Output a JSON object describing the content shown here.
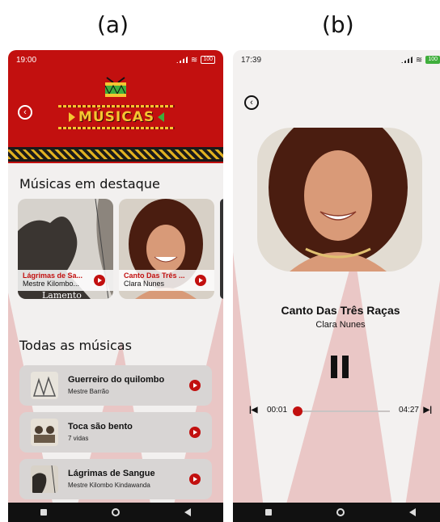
{
  "labels": {
    "a": "(a)",
    "b": "(b)"
  },
  "colors": {
    "accent": "#c2100f",
    "gold": "#f4c531",
    "green": "#3fae3c"
  },
  "screenA": {
    "status": {
      "time": "19:00",
      "battery": "100"
    },
    "header_title": "MÚSICAS",
    "featured_title": "Músicas em destaque",
    "featured": [
      {
        "title": "Lágrimas de Sa...",
        "artist": "Mestre Kilombo...",
        "caption": "Lamento"
      },
      {
        "title": "Canto Das Três ...",
        "artist": "Clara Nunes"
      }
    ],
    "all_title": "Todas as músicas",
    "songs": [
      {
        "title": "Guerreiro do quilombo",
        "artist": "Mestre Barrão"
      },
      {
        "title": "Toca são bento",
        "artist": "7 vidas"
      },
      {
        "title": "Lágrimas de Sangue",
        "artist": "Mestre Kilombo Kindawanda"
      }
    ]
  },
  "screenB": {
    "status": {
      "time": "17:39",
      "battery": "100"
    },
    "song_title": "Canto Das Três Raças",
    "artist": "Clara Nunes",
    "current_time": "00:01",
    "duration": "04:27",
    "progress": 0.0
  }
}
